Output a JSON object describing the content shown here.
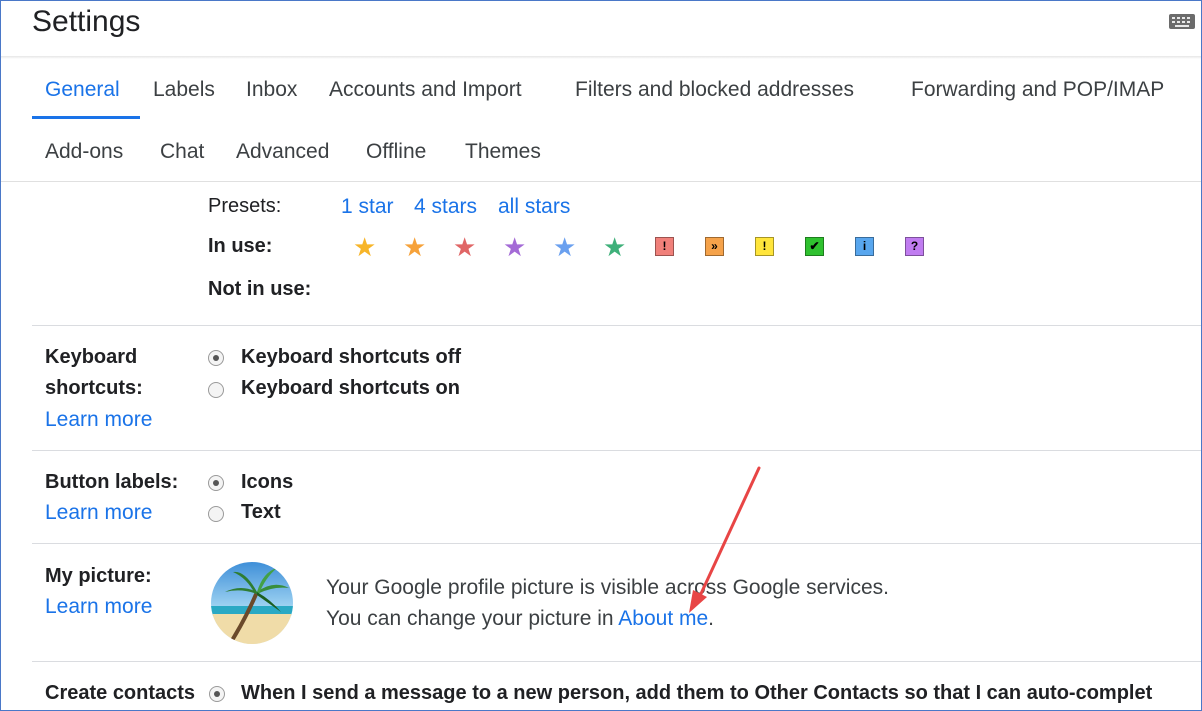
{
  "header": {
    "title": "Settings"
  },
  "tabs_row1": [
    "General",
    "Labels",
    "Inbox",
    "Accounts and Import",
    "Filters and blocked addresses",
    "Forwarding and POP/IMAP"
  ],
  "tabs_row2": [
    "Add-ons",
    "Chat",
    "Advanced",
    "Offline",
    "Themes"
  ],
  "stars": {
    "presets_label": "Presets:",
    "presets": [
      "1 star",
      "4 stars",
      "all stars"
    ],
    "in_use_label": "In use:",
    "not_in_use_label": "Not in use:",
    "in_use_icons": [
      {
        "name": "yellow-star-icon",
        "glyph": "★",
        "color": "#f7b529"
      },
      {
        "name": "orange-star-icon",
        "glyph": "★",
        "color": "#f6a23a"
      },
      {
        "name": "red-star-icon",
        "glyph": "★",
        "color": "#e06666"
      },
      {
        "name": "purple-star-icon",
        "glyph": "★",
        "color": "#a46bd6"
      },
      {
        "name": "blue-star-icon",
        "glyph": "★",
        "color": "#6aa0ef"
      },
      {
        "name": "green-star-icon",
        "glyph": "★",
        "color": "#3fb07a"
      },
      {
        "name": "red-bang-icon",
        "glyph": "!",
        "color": "#f0807a"
      },
      {
        "name": "orange-guillemet-icon",
        "glyph": "»",
        "color": "#f5a24a"
      },
      {
        "name": "yellow-bang-icon",
        "glyph": "!",
        "color": "#ffe53b"
      },
      {
        "name": "green-check-icon",
        "glyph": "✔",
        "color": "#2fc12f"
      },
      {
        "name": "blue-info-icon",
        "glyph": "i",
        "color": "#58a6ee"
      },
      {
        "name": "purple-question-icon",
        "glyph": "?",
        "color": "#c07cf0"
      }
    ]
  },
  "keyboard": {
    "label_line1": "Keyboard",
    "label_line2": "shortcuts:",
    "learn_more": "Learn more",
    "options": [
      "Keyboard shortcuts off",
      "Keyboard shortcuts on"
    ],
    "selected_index": 0
  },
  "button_labels": {
    "label": "Button labels:",
    "learn_more": "Learn more",
    "options": [
      "Icons",
      "Text"
    ],
    "selected_index": 0
  },
  "picture": {
    "label": "My picture:",
    "learn_more": "Learn more",
    "line1": "Your Google profile picture is visible across Google services.",
    "line2_prefix": "You can change your picture in ",
    "about_link": "About me",
    "line2_suffix": "."
  },
  "contacts": {
    "label": "Create contacts",
    "option": "When I send a message to a new person, add them to Other Contacts so that I can auto-complet"
  },
  "annotation": {
    "arrow_color": "#e84545"
  }
}
